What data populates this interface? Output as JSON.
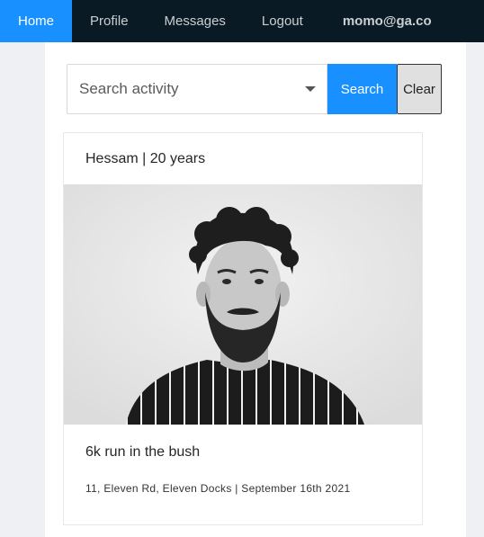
{
  "nav": {
    "items": [
      {
        "label": "Home",
        "active": true
      },
      {
        "label": "Profile"
      },
      {
        "label": "Messages"
      },
      {
        "label": "Logout"
      }
    ],
    "user_email": "momo@ga.co"
  },
  "search": {
    "placeholder": "Search activity",
    "search_label": "Search",
    "clear_label": "Clear"
  },
  "card": {
    "header": "Hessam | 20 years",
    "title": "6k run in the bush",
    "description": "11, Eleven Rd, Eleven Docks | September 16th 2021"
  },
  "colors": {
    "accent": "#1890ff",
    "navbar": "#0a1a24",
    "page_bg": "#eef0f4"
  }
}
